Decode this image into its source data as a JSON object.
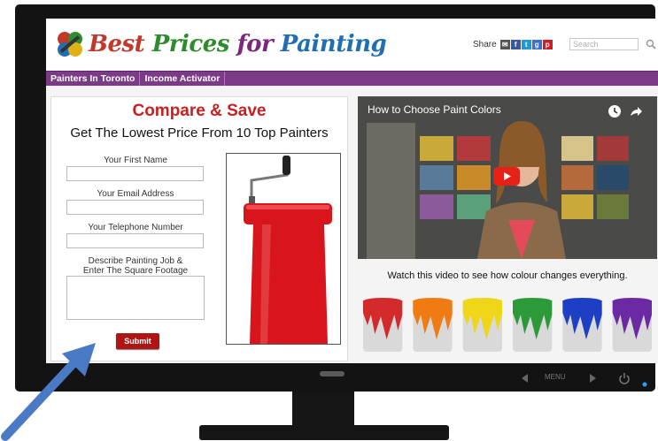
{
  "header": {
    "logo_words": [
      "Best",
      "Prices",
      "for",
      "Painting"
    ],
    "share_label": "Share",
    "share_icons": [
      "email-icon",
      "facebook-icon",
      "twitter-icon",
      "google-icon",
      "pinterest-icon"
    ],
    "search_placeholder": "Search"
  },
  "nav": {
    "items": [
      {
        "label": "Painters In Toronto"
      },
      {
        "label": "Income Activator"
      }
    ]
  },
  "form": {
    "title": "Compare & Save",
    "subtitle": "Get The Lowest Price From 10 Top Painters",
    "first_name_label": "Your First Name",
    "email_label": "Your Email Address",
    "phone_label": "Your Telephone Number",
    "job_label_line1": "Describe Painting Job &",
    "job_label_line2": "Enter The Square Footage",
    "submit_label": "Submit"
  },
  "video": {
    "title": "How to Choose Paint Colors",
    "caption": "Watch this video to see how colour changes everything."
  },
  "monitor": {
    "menu_label": "MENU"
  },
  "colors": {
    "accent": "#7b3b86",
    "title_red": "#c91f1f",
    "submit_red": "#b01515",
    "arrow_blue": "#4a79c5",
    "can_colors": [
      "#d32b2b",
      "#ef7b12",
      "#f0d619",
      "#2c9a39",
      "#1d3fc4",
      "#6b2aa3"
    ]
  }
}
